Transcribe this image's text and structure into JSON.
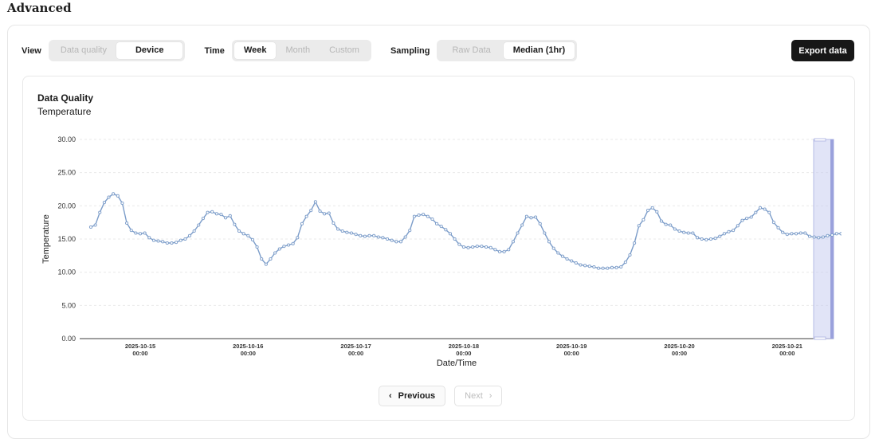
{
  "page": {
    "title": "Advanced"
  },
  "controls": {
    "view": {
      "label": "View",
      "options": [
        "Data quality",
        "Device"
      ],
      "selected": "Device"
    },
    "time": {
      "label": "Time",
      "options": [
        "Week",
        "Month",
        "Custom"
      ],
      "selected": "Week"
    },
    "sampling": {
      "label": "Sampling",
      "options": [
        "Raw Data",
        "Median (1hr)"
      ],
      "selected": "Median (1hr)"
    },
    "export_label": "Export data"
  },
  "chart": {
    "title": "Data Quality",
    "subtitle": "Temperature"
  },
  "pager": {
    "previous_label": "Previous",
    "next_label": "Next",
    "prev_icon": "chevron-left-icon",
    "next_icon": "chevron-right-icon"
  },
  "colors": {
    "line": "#7b9cc9",
    "brush": "#c9cdf0",
    "accent_dark": "#171717"
  },
  "chart_data": {
    "type": "line",
    "title": "Data Quality",
    "subtitle": "Temperature",
    "xlabel": "Date/Time",
    "ylabel": "Temperature",
    "ylim": [
      0,
      30
    ],
    "yticks": [
      "0.00",
      "5.00",
      "10.00",
      "15.00",
      "20.00",
      "25.00",
      "30.00"
    ],
    "xticks": [
      {
        "date": "2025-10-15",
        "time": "00:00"
      },
      {
        "date": "2025-10-16",
        "time": "00:00"
      },
      {
        "date": "2025-10-17",
        "time": "00:00"
      },
      {
        "date": "2025-10-18",
        "time": "00:00"
      },
      {
        "date": "2025-10-19",
        "time": "00:00"
      },
      {
        "date": "2025-10-20",
        "time": "00:00"
      },
      {
        "date": "2025-10-21",
        "time": "00:00"
      }
    ],
    "x_start": "2025-10-14 13:00",
    "interval": "1h",
    "grid": true,
    "series": [
      {
        "values": [
          16.8,
          17.1,
          19.0,
          20.5,
          21.3,
          21.8,
          21.5,
          20.4,
          17.4,
          16.3,
          15.9,
          15.8,
          15.9,
          15.2,
          14.8,
          14.7,
          14.6,
          14.4,
          14.4,
          14.5,
          14.8,
          15.0,
          15.5,
          16.2,
          17.1,
          18.1,
          19.0,
          19.1,
          18.8,
          18.7,
          18.2,
          18.5,
          17.2,
          16.2,
          15.8,
          15.5,
          14.9,
          13.8,
          12.0,
          11.2,
          12.0,
          12.9,
          13.5,
          13.9,
          14.1,
          14.3,
          15.2,
          17.3,
          18.4,
          19.3,
          20.6,
          19.2,
          18.8,
          18.9,
          17.4,
          16.5,
          16.2,
          16.0,
          15.9,
          15.7,
          15.5,
          15.4,
          15.5,
          15.5,
          15.3,
          15.2,
          15.0,
          14.8,
          14.6,
          14.6,
          15.3,
          16.3,
          18.4,
          18.6,
          18.7,
          18.4,
          18.0,
          17.3,
          16.9,
          16.4,
          15.8,
          15.0,
          14.2,
          13.8,
          13.7,
          13.8,
          13.9,
          13.9,
          13.8,
          13.7,
          13.4,
          13.1,
          13.1,
          13.4,
          14.6,
          15.9,
          17.1,
          18.4,
          18.2,
          18.3,
          17.3,
          15.9,
          14.6,
          13.6,
          12.9,
          12.4,
          12.0,
          11.7,
          11.4,
          11.1,
          11.0,
          10.9,
          10.8,
          10.6,
          10.6,
          10.6,
          10.7,
          10.7,
          10.8,
          11.5,
          12.6,
          14.4,
          17.0,
          17.9,
          19.3,
          19.7,
          19.1,
          17.7,
          17.2,
          17.1,
          16.5,
          16.2,
          16.0,
          15.9,
          15.9,
          15.2,
          15.0,
          14.9,
          15.0,
          15.1,
          15.4,
          15.8,
          16.1,
          16.3,
          17.0,
          17.8,
          18.1,
          18.3,
          19.0,
          19.7,
          19.5,
          19.0,
          17.5,
          16.7,
          16.0,
          15.7,
          15.8,
          15.8,
          15.9,
          15.9,
          15.4,
          15.3,
          15.2,
          15.3,
          15.5,
          15.6,
          15.8,
          15.8,
          16.2
        ]
      }
    ]
  }
}
